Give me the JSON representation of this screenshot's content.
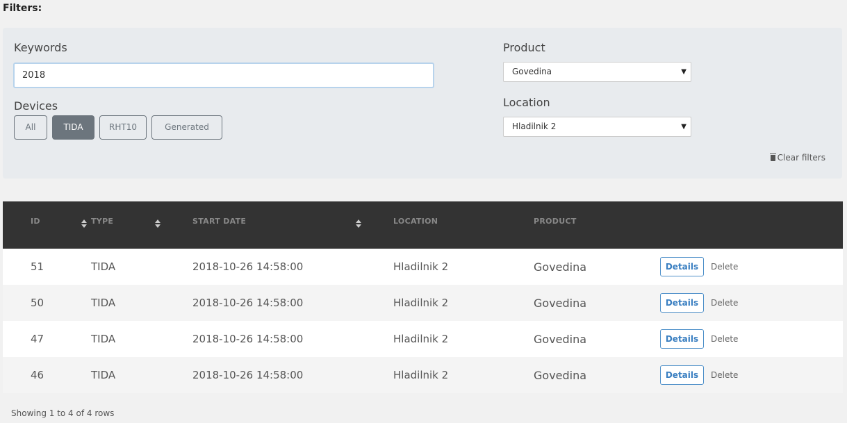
{
  "filters_heading": "Filters:",
  "keywords": {
    "label": "Keywords",
    "value": "2018"
  },
  "devices": {
    "label": "Devices",
    "buttons": [
      "All",
      "TIDA",
      "RHT10",
      "Generated"
    ],
    "active": "TIDA"
  },
  "product": {
    "label": "Product",
    "selected": "Govedina"
  },
  "location": {
    "label": "Location",
    "selected": "Hladilnik 2"
  },
  "clear_filters": "Clear filters",
  "table": {
    "columns": [
      "ID",
      "TYPE",
      "START DATE",
      "LOCATION",
      "PRODUCT"
    ],
    "rows": [
      {
        "id": "51",
        "type": "TIDA",
        "start_date": "2018-10-26 14:58:00",
        "location": "Hladilnik 2",
        "product": "Govedina"
      },
      {
        "id": "50",
        "type": "TIDA",
        "start_date": "2018-10-26 14:58:00",
        "location": "Hladilnik 2",
        "product": "Govedina"
      },
      {
        "id": "47",
        "type": "TIDA",
        "start_date": "2018-10-26 14:58:00",
        "location": "Hladilnik 2",
        "product": "Govedina"
      },
      {
        "id": "46",
        "type": "TIDA",
        "start_date": "2018-10-26 14:58:00",
        "location": "Hladilnik 2",
        "product": "Govedina"
      }
    ],
    "details_label": "Details",
    "delete_label": "Delete"
  },
  "showing": "Showing 1 to 4 of 4 rows",
  "colors": {
    "header_bg": "#333333",
    "details_blue": "#3a7fc1",
    "active_btn": "#6c757d"
  }
}
